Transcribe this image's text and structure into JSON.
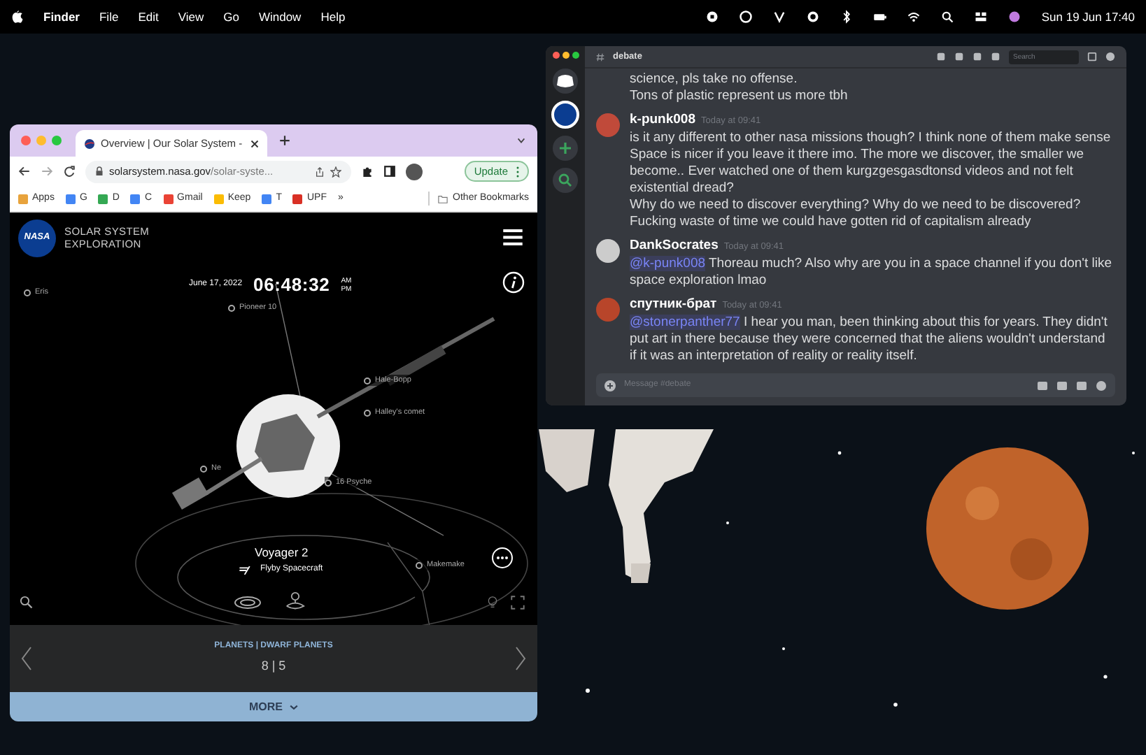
{
  "menubar": {
    "app": "Finder",
    "menus": [
      "File",
      "Edit",
      "View",
      "Go",
      "Window",
      "Help"
    ],
    "clock": "Sun 19 Jun 17:40"
  },
  "browser": {
    "tabs": [
      {
        "title": "Overview | Our Solar System -",
        "selected": true
      }
    ],
    "url_domain": "solarsystem.nasa.gov",
    "url_path": "/solar-syste...",
    "update_label": "Update",
    "bookmarks": [
      {
        "label": "Apps",
        "color": "#e8a33c"
      },
      {
        "label": "G",
        "color": "#4285f4"
      },
      {
        "label": "D",
        "color": "#34a853"
      },
      {
        "label": "C",
        "color": "#4285f4"
      },
      {
        "label": "Gmail",
        "color": "#ea4335"
      },
      {
        "label": "Keep",
        "color": "#fbbc04"
      },
      {
        "label": "T",
        "color": "#4285f4"
      },
      {
        "label": "UPF",
        "color": "#d93025"
      }
    ],
    "more_bookmarks": "»",
    "other_bookmarks": "Other Bookmarks"
  },
  "nasa": {
    "logo": "NASA",
    "site_title": [
      "SOLAR SYSTEM",
      "EXPLORATION"
    ],
    "date": "June 17, 2022",
    "time": "06:48:32",
    "meridiem": [
      "AM",
      "PM"
    ],
    "labels": [
      {
        "text": "Eris"
      },
      {
        "text": "Pioneer 10"
      },
      {
        "text": "Hale-Bopp"
      },
      {
        "text": "Halley's comet"
      },
      {
        "text": "Ne"
      },
      {
        "text": "16 Psyche"
      },
      {
        "text": "Makemake"
      }
    ],
    "spacecraft": "Voyager 2",
    "spacecraft_type": "Flyby Spacecraft",
    "category": "PLANETS | DWARF PLANETS",
    "counts": "8 | 5",
    "more": "MORE"
  },
  "discord": {
    "channel": "debate",
    "search_placeholder": "Search",
    "input_placeholder": "Message #debate",
    "messages": [
      {
        "paragraphs": [
          {
            "text": "science, pls take no offense."
          },
          {
            "text": "Tons of plastic represent us more tbh"
          }
        ]
      },
      {
        "author": "k-punk008",
        "time": "Today at 09:41",
        "paragraphs": [
          {
            "text": "is it any different to other nasa missions though? I think none of them make sense"
          },
          {
            "text": "Space is nicer if you leave it there imo. The more we discover, the smaller we become.. Ever watched one of them kurgzgesgasdtonsd videos and not felt existential dread?"
          },
          {
            "text": "Why do we need to discover everything? Why do we need to be discovered? Fucking waste of time we could have gotten rid of capitalism already"
          }
        ]
      },
      {
        "author": "DankSocrates",
        "time": "Today at 09:41",
        "paragraphs": [
          {
            "mention": "@k-punk008",
            "text": " Thoreau much? Also why are you in a space channel if you don't like space exploration lmao"
          }
        ]
      },
      {
        "author": "спутник-брат",
        "time": "Today at 09:41",
        "paragraphs": [
          {
            "mention": "@stonerpanther77",
            "text": " I hear you man, been thinking about this for years. They didn't put art in there because they were concerned that the aliens wouldn't understand if it was an interpretation of reality or reality itself."
          }
        ]
      }
    ]
  }
}
